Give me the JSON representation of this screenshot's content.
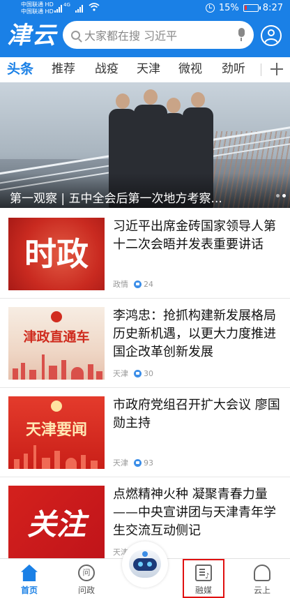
{
  "status_bar": {
    "carrier1": "中国联通",
    "carrier1_tag": "HD",
    "carrier2": "中国联通",
    "carrier2_tag": "HD",
    "network": "4G",
    "battery": "15%",
    "battery_level": 0.15,
    "time": "8:27"
  },
  "header": {
    "logo": "津云",
    "search_placeholder": "大家都在搜 习近平"
  },
  "tabs": [
    "头条",
    "推荐",
    "战疫",
    "天津",
    "微视",
    "劲听"
  ],
  "hero": {
    "caption": "第一观察 | 五中全会后第一次地方考察..."
  },
  "news": [
    {
      "title": "习近平出席金砖国家领导人第十二次会晤并发表重要讲话",
      "source": "政情",
      "likes": "24",
      "thumb_text": "时政"
    },
    {
      "title": "李鸿忠：抢抓构建新发展格局历史新机遇，以更大力度推进国企改革创新发展",
      "source": "天津",
      "likes": "30",
      "thumb_text": "津政直通车"
    },
    {
      "title": "市政府党组召开扩大会议 廖国勋主持",
      "source": "天津",
      "likes": "93",
      "thumb_text": "天津要闻"
    },
    {
      "title": "点燃精神火种 凝聚青春力量——中央宣讲团与天津青年学生交流互动侧记",
      "source": "天津",
      "likes": "",
      "thumb_text": "关注"
    }
  ],
  "bottom_nav": [
    "首页",
    "问政",
    "融媒",
    "云上"
  ],
  "ask_icon_char": "问",
  "colors": {
    "brand": "#1a80e6",
    "highlight_box": "#e01010"
  }
}
